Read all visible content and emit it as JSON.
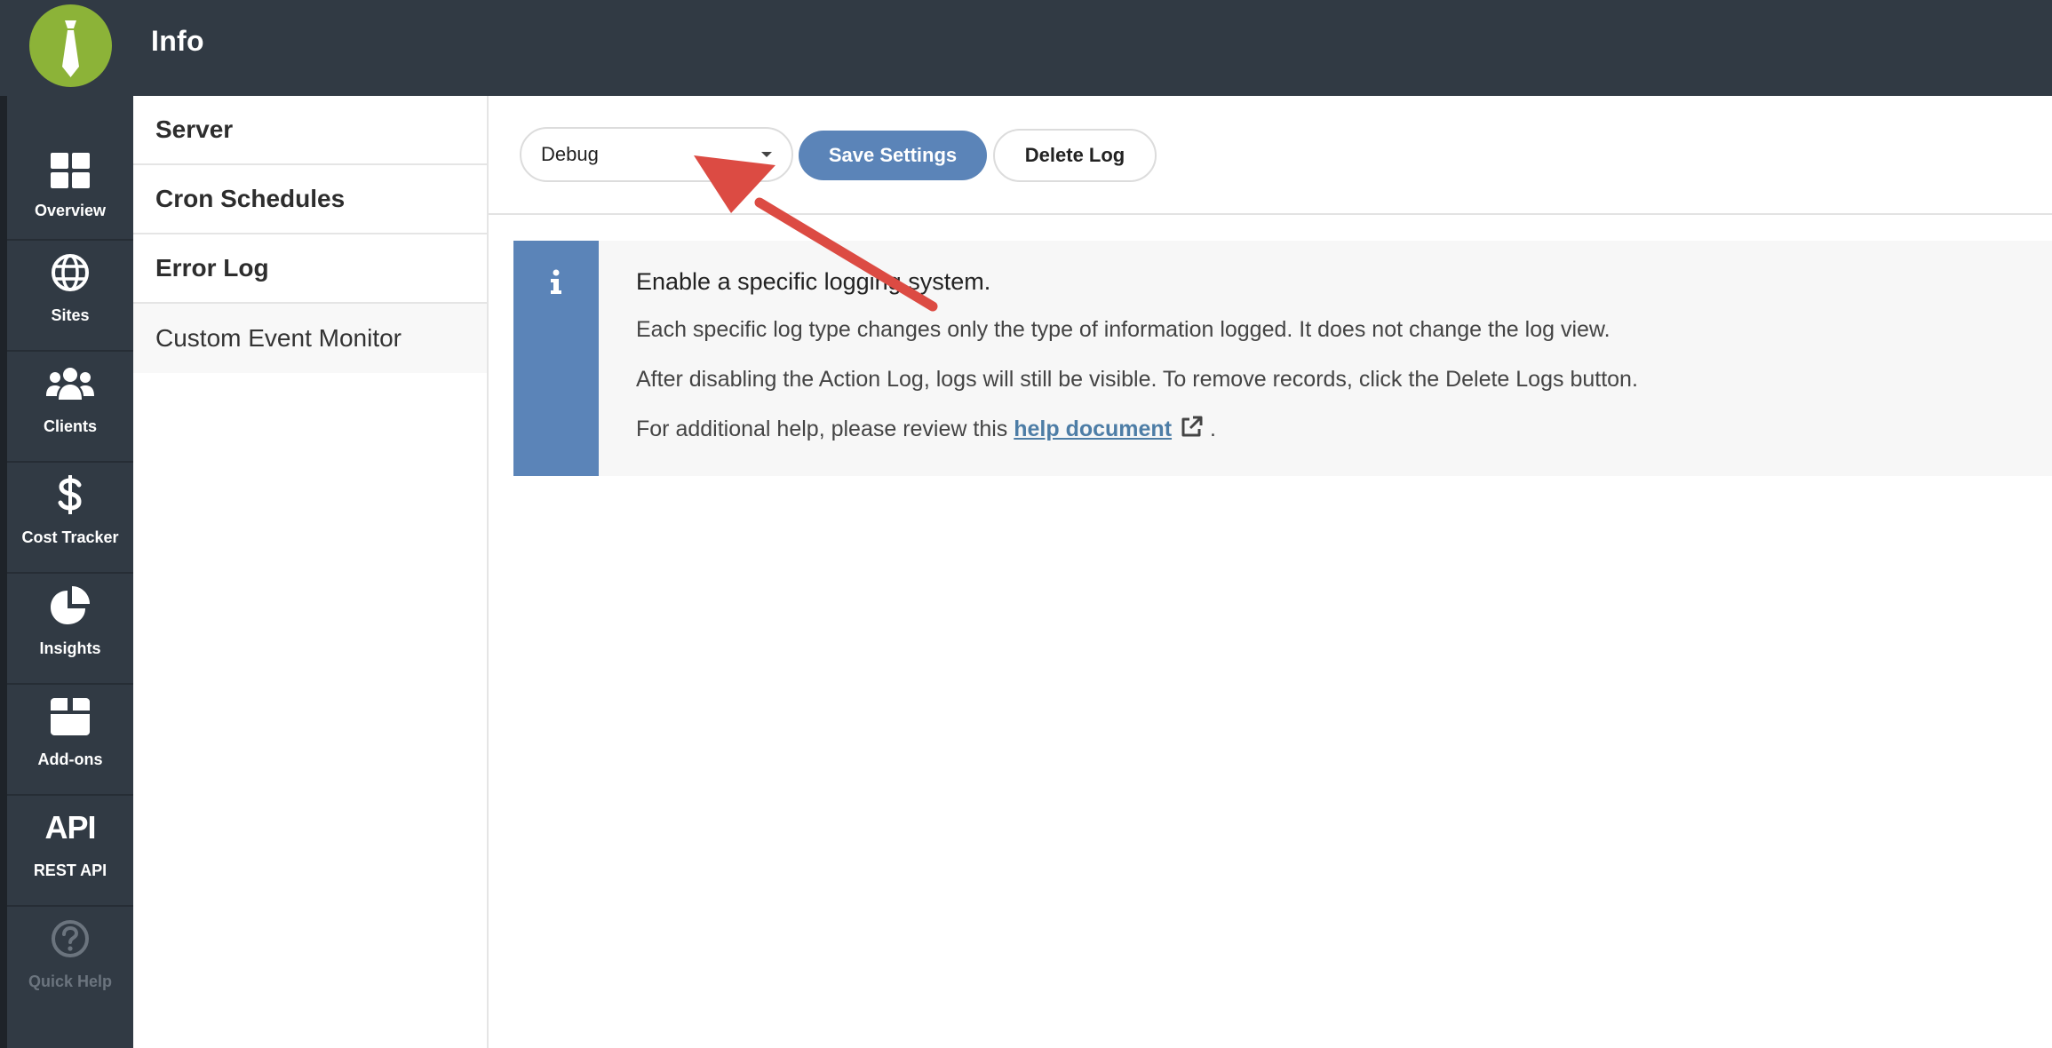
{
  "header": {
    "title": "Info"
  },
  "rail": {
    "items": [
      {
        "label": "Overview",
        "icon": "grid-icon"
      },
      {
        "label": "Sites",
        "icon": "globe-icon"
      },
      {
        "label": "Clients",
        "icon": "users-icon"
      },
      {
        "label": "Cost Tracker",
        "icon": "dollar-icon"
      },
      {
        "label": "Insights",
        "icon": "pie-chart-icon"
      },
      {
        "label": "Add-ons",
        "icon": "box-icon"
      },
      {
        "label": "REST API",
        "icon_text": "API"
      },
      {
        "label": "Quick Help",
        "icon": "question-circle-icon"
      }
    ]
  },
  "subnav": {
    "items": [
      {
        "label": "Server"
      },
      {
        "label": "Cron Schedules"
      },
      {
        "label": "Error Log"
      },
      {
        "label": "Custom Event Monitor"
      }
    ]
  },
  "toolbar": {
    "log_type_value": "Debug",
    "save_label": "Save Settings",
    "delete_label": "Delete Log"
  },
  "notice": {
    "title": "Enable a specific logging system.",
    "line1": "Each specific log type changes only the type of information logged. It does not change the log view.",
    "line2": "After disabling the Action Log, logs will still be visible. To remove records, click the Delete Logs button.",
    "line3_prefix": "For additional help, please review this",
    "link_text": "help document",
    "line3_suffix": "."
  },
  "colors": {
    "header_bg": "#313a44",
    "logo_green": "#8cb338",
    "accent_blue": "#5b84b8",
    "arrow_red": "#dc4b43"
  }
}
